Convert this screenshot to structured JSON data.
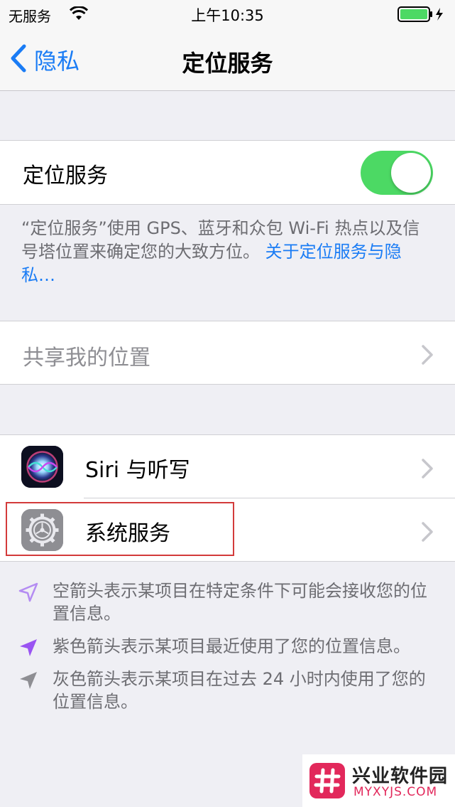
{
  "status_bar": {
    "carrier": "无服务",
    "time": "上午10:35"
  },
  "nav": {
    "back_label": "隐私",
    "title": "定位服务"
  },
  "location_services": {
    "label": "定位服务",
    "enabled": true
  },
  "description": {
    "text": "“定位服务”使用 GPS、蓝牙和众包 Wi-Fi 热点以及信号塔位置来确定您的大致方位。",
    "link": "关于定位服务与隐私…"
  },
  "share_location": {
    "label": "共享我的位置"
  },
  "apps": [
    {
      "label": "Siri 与听写",
      "icon": "siri-icon"
    },
    {
      "label": "系统服务",
      "icon": "gear-icon"
    }
  ],
  "legend": [
    {
      "icon": "hollow-arrow-icon",
      "color": "#b48cf2",
      "text": "空箭头表示某项目在特定条件下可能会接收您的位置信息。"
    },
    {
      "icon": "purple-arrow-icon",
      "color": "#9a54f2",
      "text": "紫色箭头表示某项目最近使用了您的位置信息。"
    },
    {
      "icon": "gray-arrow-icon",
      "color": "#8e8e93",
      "text": "灰色箭头表示某项目在过去 24 小时内使用了您的位置信息。"
    }
  ],
  "watermark": {
    "title": "兴业软件园",
    "url": "MYXYJS.COM"
  },
  "colors": {
    "accent": "#1a7cf5",
    "toggle_on": "#4cd964",
    "highlight": "#d33b3b"
  }
}
